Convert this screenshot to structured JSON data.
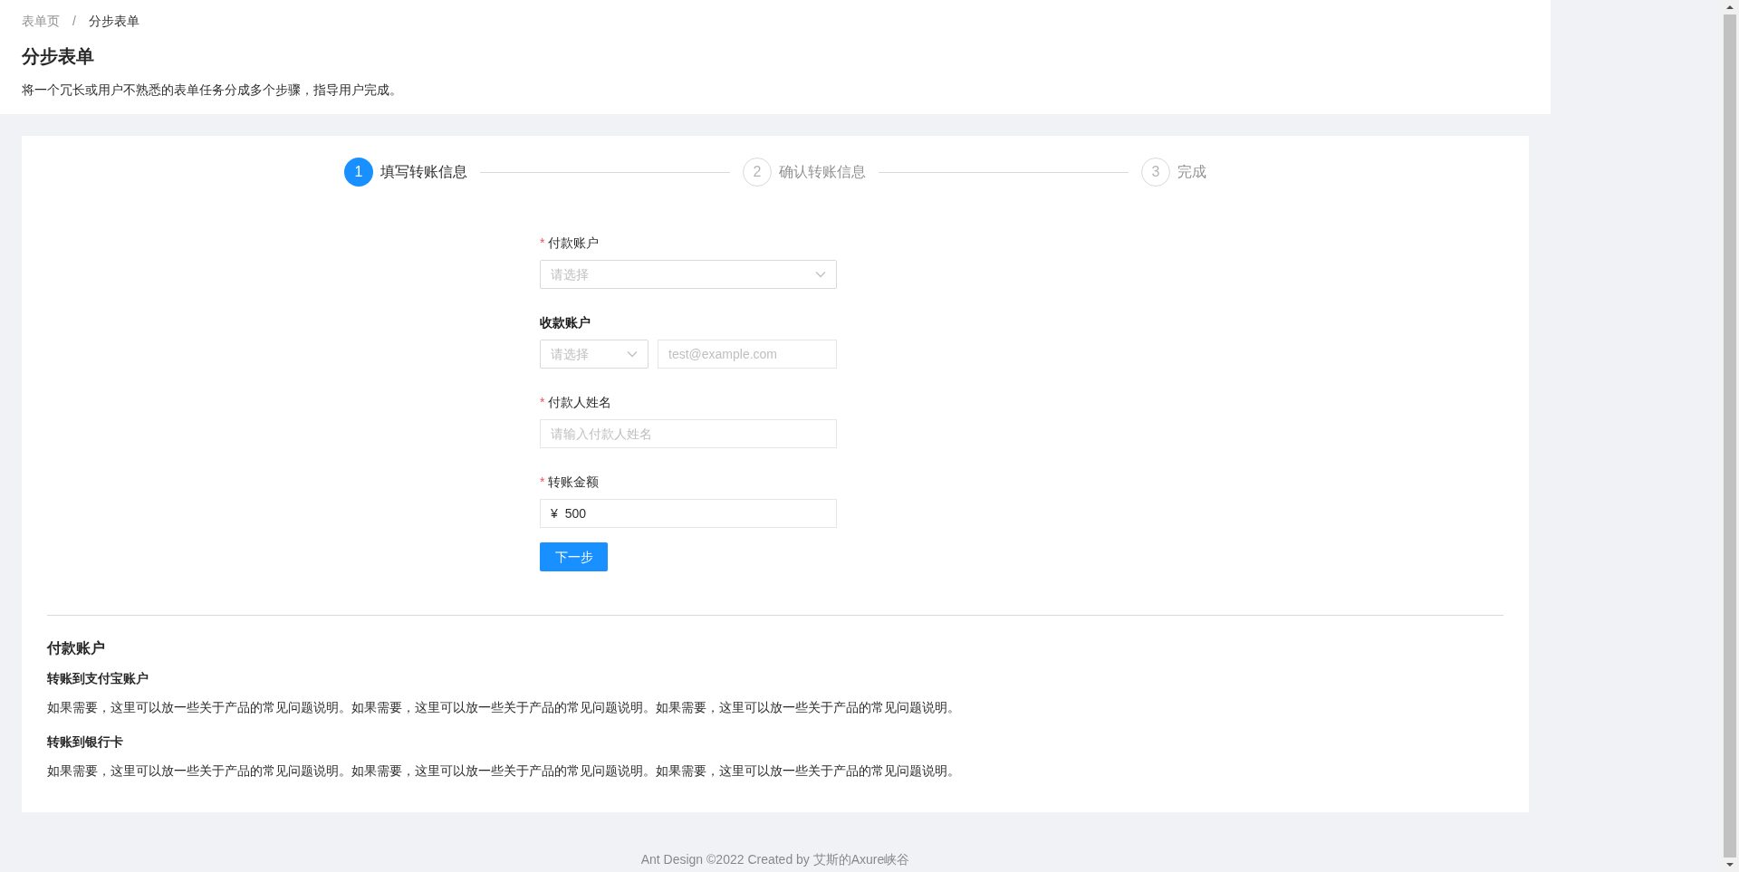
{
  "breadcrumb": [
    {
      "label": "表单页",
      "current": false
    },
    {
      "separator": "/",
      "label": "分步表单",
      "current": true
    }
  ],
  "title": "分步表单",
  "description": "将一个冗长或用户不熟悉的表单任务分成多个步骤，指导用户完成。",
  "steps": [
    {
      "number": "1",
      "title": "填写转账信息",
      "selected": true
    },
    {
      "number": "2",
      "title": "确认转账信息",
      "selected": false
    },
    {
      "number": "3",
      "title": "完成",
      "selected": false
    }
  ],
  "form": [
    {
      "kind": "select",
      "label": "付款账户",
      "required_mark": "*",
      "placeholder": "请选择"
    },
    {
      "kind": "select_input",
      "label": "收款账户",
      "placeholder": "请选择",
      "input_placeholder": "test@example.com"
    },
    {
      "kind": "input",
      "label": "付款人姓名",
      "required_mark": "*",
      "placeholder": "请输入付款人姓名"
    },
    {
      "kind": "amount",
      "label": "转账金额",
      "required_mark": "*",
      "prefix": "¥",
      "value": "500"
    }
  ],
  "next_button": "下一步",
  "help": {
    "title": "付款账户",
    "sections": [
      {
        "heading": "转账到支付宝账户",
        "text": "如果需要，这里可以放一些关于产品的常见问题说明。如果需要，这里可以放一些关于产品的常见问题说明。如果需要，这里可以放一些关于产品的常见问题说明。"
      },
      {
        "heading": "转账到银行卡",
        "text": "如果需要，这里可以放一些关于产品的常见问题说明。如果需要，这里可以放一些关于产品的常见问题说明。如果需要，这里可以放一些关于产品的常见问题说明。"
      }
    ]
  },
  "footer": "Ant Design ©2022 Created by 艾斯的Axure峡谷"
}
